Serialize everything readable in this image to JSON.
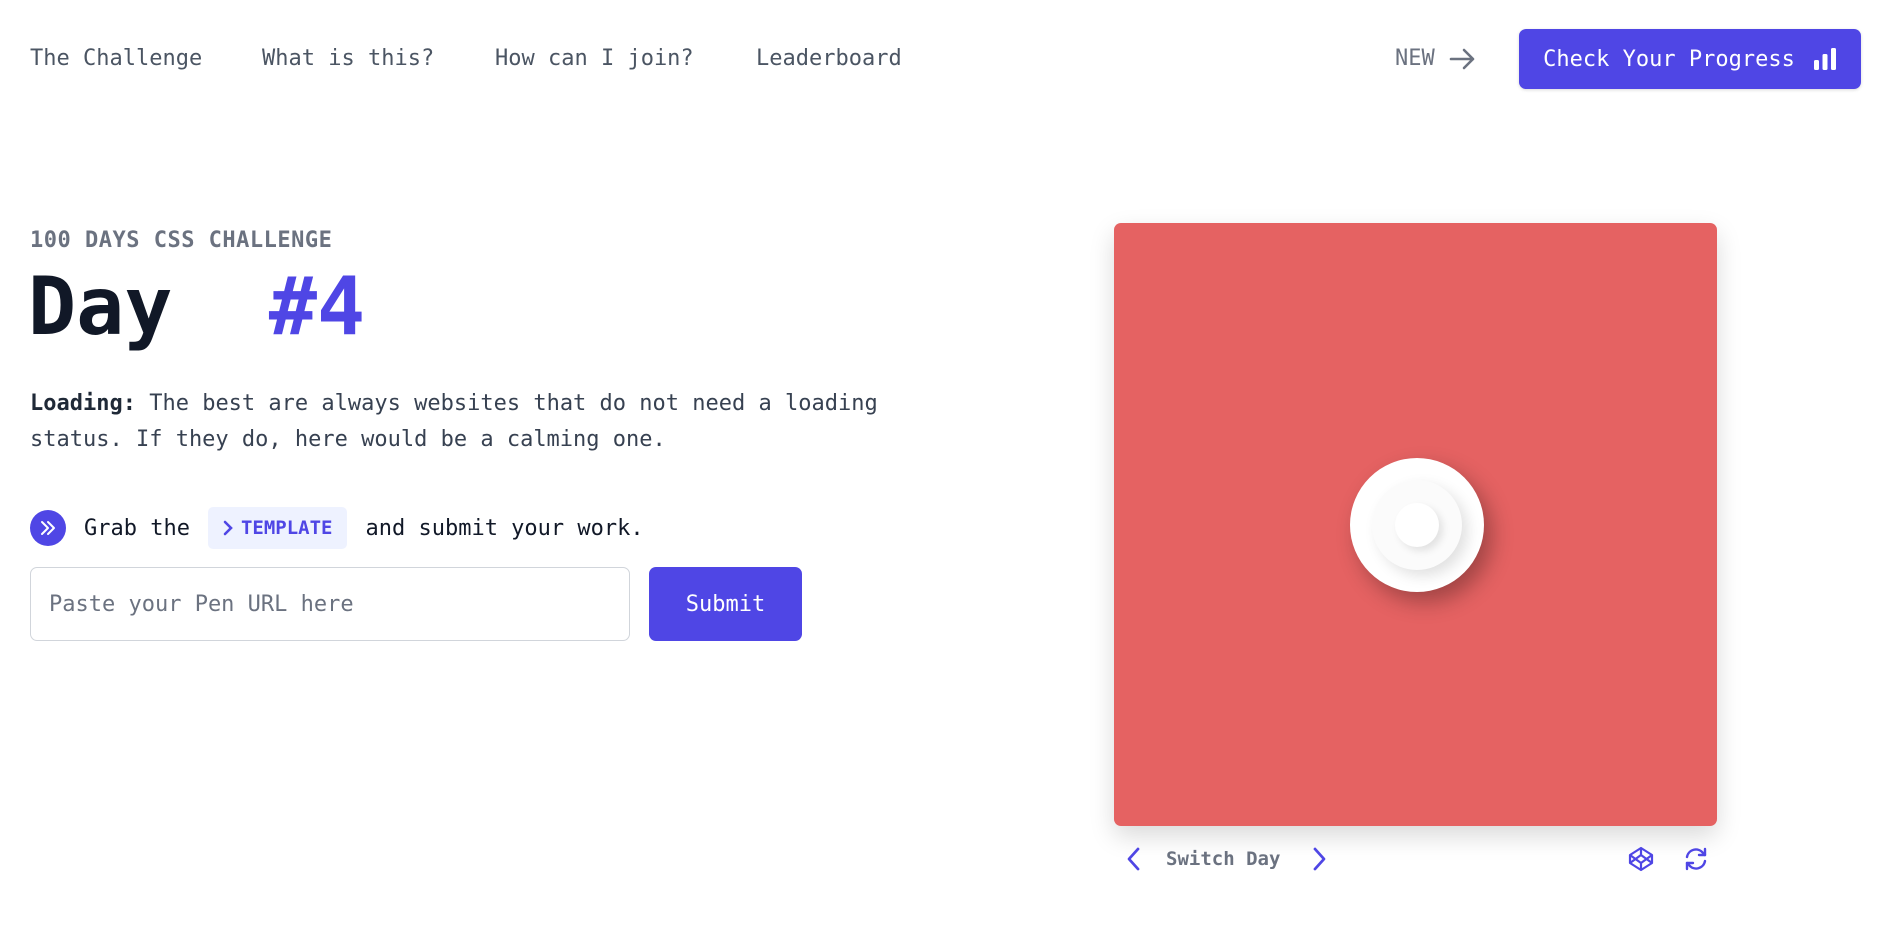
{
  "nav": {
    "items": [
      "The Challenge",
      "What is this?",
      "How can I join?",
      "Leaderboard"
    ],
    "new_label": "NEW",
    "cta_label": "Check Your Progress"
  },
  "hero": {
    "eyebrow": "100 DAYS CSS CHALLENGE",
    "title_prefix": "Day",
    "title_number": "#4",
    "desc_bold": "Loading:",
    "desc_text": " The best are always websites that do not need a loading status. If they do, here would be a calming one."
  },
  "grab": {
    "before": "Grab the",
    "template_label": "TEMPLATE",
    "after": "and submit your work."
  },
  "form": {
    "placeholder": "Paste your Pen URL here",
    "value": "",
    "submit_label": "Submit"
  },
  "preview": {
    "background": "#e56262",
    "switch_label": "Switch Day"
  },
  "colors": {
    "accent": "#4f46e5"
  }
}
